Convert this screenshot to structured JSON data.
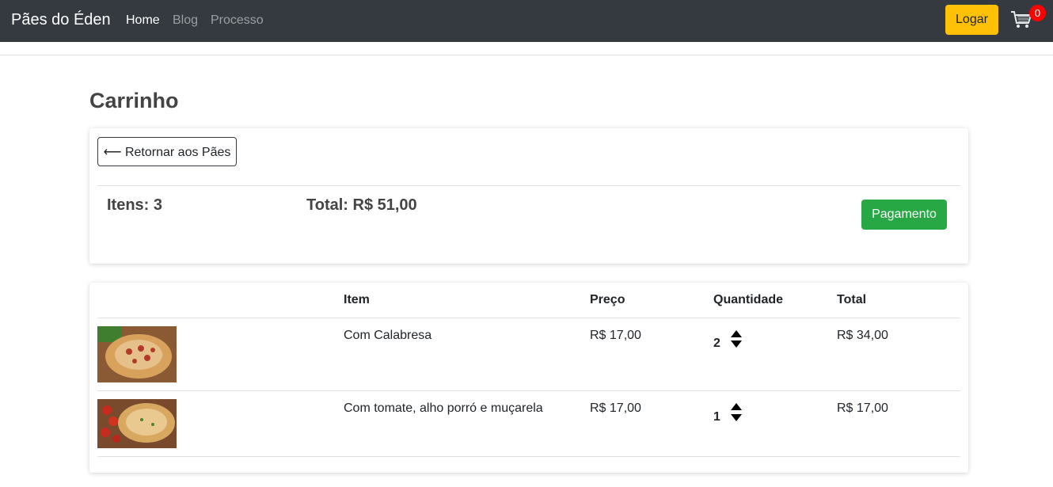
{
  "navbar": {
    "brand": "Pães do Éden",
    "links": [
      "Home",
      "Blog",
      "Processo"
    ],
    "login_label": "Logar",
    "cart_count": "0",
    "cart_icon": "shopping-cart-icon"
  },
  "page": {
    "title": "Carrinho"
  },
  "summary": {
    "back_label": "⟵ Retornar aos Pães",
    "items_label": "Itens: 3",
    "total_label": "Total: R$ 51,00",
    "pay_label": "Pagamento"
  },
  "table": {
    "headers": [
      "",
      "Item",
      "Preço",
      "Quantidade",
      "Total"
    ],
    "rows": [
      {
        "image": "bread-calabresa-image",
        "item": "Com Calabresa",
        "price": "R$ 17,00",
        "quantity": "2",
        "total": "R$ 34,00"
      },
      {
        "image": "bread-tomato-image",
        "item": "Com tomate, alho porró e muçarela",
        "price": "R$ 17,00",
        "quantity": "1",
        "total": "R$ 17,00"
      }
    ]
  },
  "colors": {
    "navbar": "#343a40",
    "login": "#ffc107",
    "pay": "#28a745",
    "badge": "#ff0000"
  }
}
